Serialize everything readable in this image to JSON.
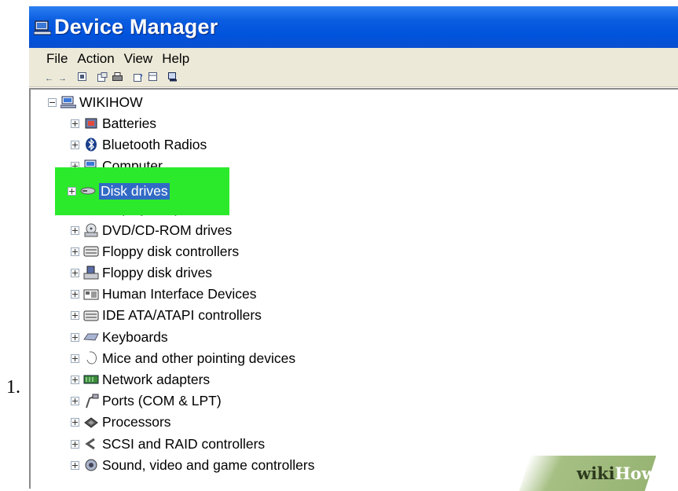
{
  "step": {
    "number": "1."
  },
  "window": {
    "title": "Device Manager",
    "menu": [
      "File",
      "Action",
      "View",
      "Help"
    ],
    "toolbar_icons": [
      "back-arrow-icon",
      "forward-arrow-icon",
      "console-tree-icon",
      "properties-icon",
      "print-icon",
      "help-icon",
      "view-icon",
      "scan-hardware-icon"
    ]
  },
  "tree": {
    "root": {
      "label": "WIKIHOW",
      "icon": "computer-icon"
    },
    "items": [
      {
        "label": "Batteries",
        "icon": "battery-icon"
      },
      {
        "label": "Bluetooth Radios",
        "icon": "bluetooth-icon"
      },
      {
        "label": "Computer",
        "icon": "computer-icon"
      },
      {
        "label": "Disk drives",
        "icon": "disk-drive-icon",
        "selected": true
      },
      {
        "label": "Display adapters",
        "icon": "display-adapter-icon"
      },
      {
        "label": "DVD/CD-ROM drives",
        "icon": "dvd-drive-icon"
      },
      {
        "label": "Floppy disk controllers",
        "icon": "controller-icon"
      },
      {
        "label": "Floppy disk drives",
        "icon": "floppy-drive-icon"
      },
      {
        "label": "Human Interface Devices",
        "icon": "hid-icon"
      },
      {
        "label": "IDE ATA/ATAPI controllers",
        "icon": "controller-icon"
      },
      {
        "label": "Keyboards",
        "icon": "keyboard-icon"
      },
      {
        "label": "Mice and other pointing devices",
        "icon": "mouse-icon"
      },
      {
        "label": "Network adapters",
        "icon": "network-adapter-icon"
      },
      {
        "label": "Ports (COM & LPT)",
        "icon": "port-icon"
      },
      {
        "label": "Processors",
        "icon": "processor-icon"
      },
      {
        "label": "SCSI and RAID controllers",
        "icon": "scsi-icon"
      },
      {
        "label": "Sound, video and game controllers",
        "icon": "sound-icon"
      }
    ]
  },
  "watermark": {
    "wiki": "wiki",
    "how": "How"
  },
  "colors": {
    "highlight": "#2bea2b",
    "selection": "#316ac5",
    "titlebar": "#0a5ce0"
  }
}
